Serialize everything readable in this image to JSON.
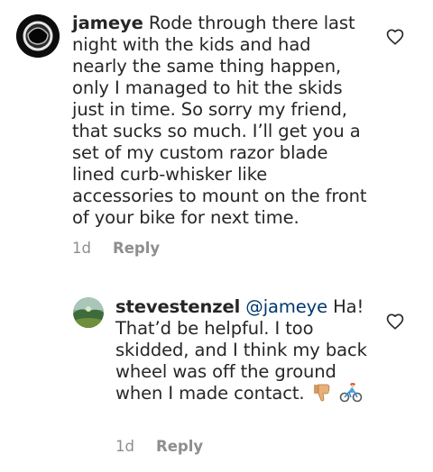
{
  "comments": [
    {
      "username": "jameye",
      "body": " Rode through there last night with the kids and had nearly the same thing happen, only I managed to hit the skids just in time. So sorry my friend, that sucks so much. I’ll get you a set of my custom razor blade lined curb-whisker like accessories to mount on the front of your bike for next time.",
      "age": "1d",
      "reply_label": "Reply",
      "avatar_icon": "astronaut-helmet-avatar",
      "like_icon": "heart-outline-icon"
    },
    {
      "username": "stevestenzel",
      "mention": "@jameye",
      "body": " Ha! That’d be helpful. I too skidded, and I think my back wheel was off the ground when I made contact.",
      "emojis": [
        "thumbs-down",
        "person-biking"
      ],
      "age": "1d",
      "reply_label": "Reply",
      "avatar_icon": "landscape-photo-avatar",
      "like_icon": "heart-outline-icon"
    }
  ],
  "colors": {
    "text": "#262626",
    "meta": "#8e8e8e",
    "mention": "#00376b"
  }
}
